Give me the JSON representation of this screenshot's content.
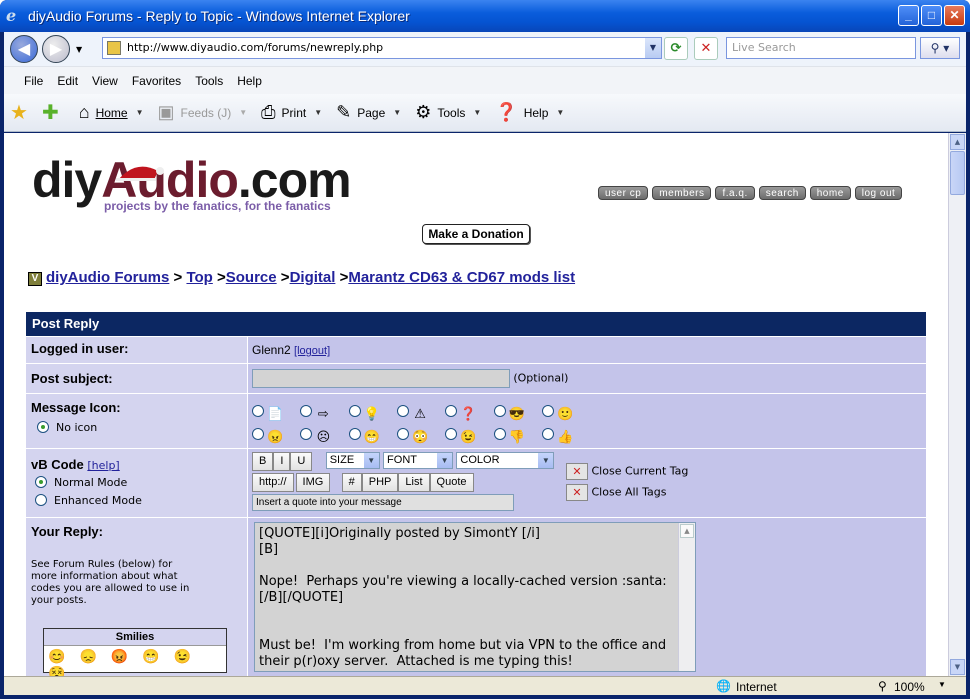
{
  "window": {
    "title": "diyAudio Forums - Reply to Topic - Windows Internet Explorer"
  },
  "browser": {
    "url": "http://www.diyaudio.com/forums/newreply.php",
    "search_placeholder": "Live Search",
    "menu": [
      "File",
      "Edit",
      "View",
      "Favorites",
      "Tools",
      "Help"
    ],
    "commands": {
      "home": "Home",
      "feeds": "Feeds (J)",
      "print": "Print",
      "page": "Page",
      "tools": "Tools",
      "help": "Help"
    }
  },
  "site": {
    "logo_diy": "diy",
    "logo_audio": "Audio",
    "logo_com": ".com",
    "tagline": "projects by the fanatics, for the fanatics",
    "toplinks": [
      "user cp",
      "members",
      "f.a.q.",
      "search",
      "home",
      "log out"
    ],
    "donate": "Make a Donation"
  },
  "breadcrumb": {
    "icon": "V",
    "items": [
      "diyAudio Forums",
      "Top",
      "Source",
      "Digital",
      "Marantz CD63 & CD67 mods list"
    ],
    "sep": ">"
  },
  "form": {
    "header": "Post Reply",
    "logged_label": "Logged in user:",
    "username": "Glenn2",
    "logout": "[logout]",
    "subject_label": "Post subject:",
    "subject_value": "",
    "optional": "(Optional)",
    "icon_label": "Message Icon:",
    "no_icon": "No icon",
    "vb_label": "vB Code",
    "vb_help": "[help]",
    "normal_mode": "Normal Mode",
    "enhanced_mode": "Enhanced Mode",
    "b": "B",
    "i": "I",
    "u": "U",
    "size": "SIZE",
    "font": "FONT",
    "color": "COLOR",
    "http": "http://",
    "img": "IMG",
    "hash": "#",
    "php": "PHP",
    "list": "List",
    "quote": "Quote",
    "hint": "Insert a quote into your message",
    "close_tag": "Close Current Tag",
    "close_all": "Close All Tags",
    "reply_label": "Your Reply:",
    "reply_note": "See Forum Rules (below) for more information about what codes you are allowed to use in your posts.",
    "message": "[QUOTE][i]Originally posted by SimontY [/i]\n[B]\n\nNope!  Perhaps you're viewing a locally-cached version :santa:\n[/B][/QUOTE]\n\n\nMust be!  I'm working from home but via VPN to the office and\ntheir p(r)oxy server.  Attached is me typing this!",
    "smilies_title": "Smilies"
  },
  "status": {
    "zone": "Internet",
    "zoom": "100%"
  }
}
